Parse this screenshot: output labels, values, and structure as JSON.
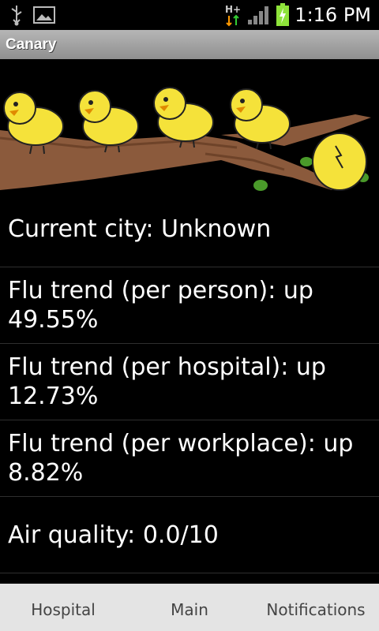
{
  "status_bar": {
    "time": "1:16 PM",
    "network_label": "H+",
    "icons": [
      "usb-icon",
      "image-icon",
      "network-h-plus-icon",
      "signal-icon",
      "battery-charging-icon"
    ]
  },
  "app": {
    "title": "Canary"
  },
  "info": {
    "city": "Current city: Unknown",
    "trend_person": [
      "Flu trend (per person): up",
      "49.55%"
    ],
    "trend_hospital": [
      "Flu trend (per hospital): up",
      "12.73%"
    ],
    "trend_workplace": [
      "Flu trend (per workplace): up",
      "8.82%"
    ],
    "air_quality": "Air quality: 0.0/10"
  },
  "tabs": {
    "hospital": "Hospital",
    "main": "Main",
    "notifications": "Notifications"
  },
  "colors": {
    "background": "#000000",
    "title_bar": "#a3a3a3",
    "tab_bar": "#e4e4e4",
    "canary": "#f5e23a",
    "branch": "#8b5a3c",
    "battery": "#8ee33a"
  }
}
